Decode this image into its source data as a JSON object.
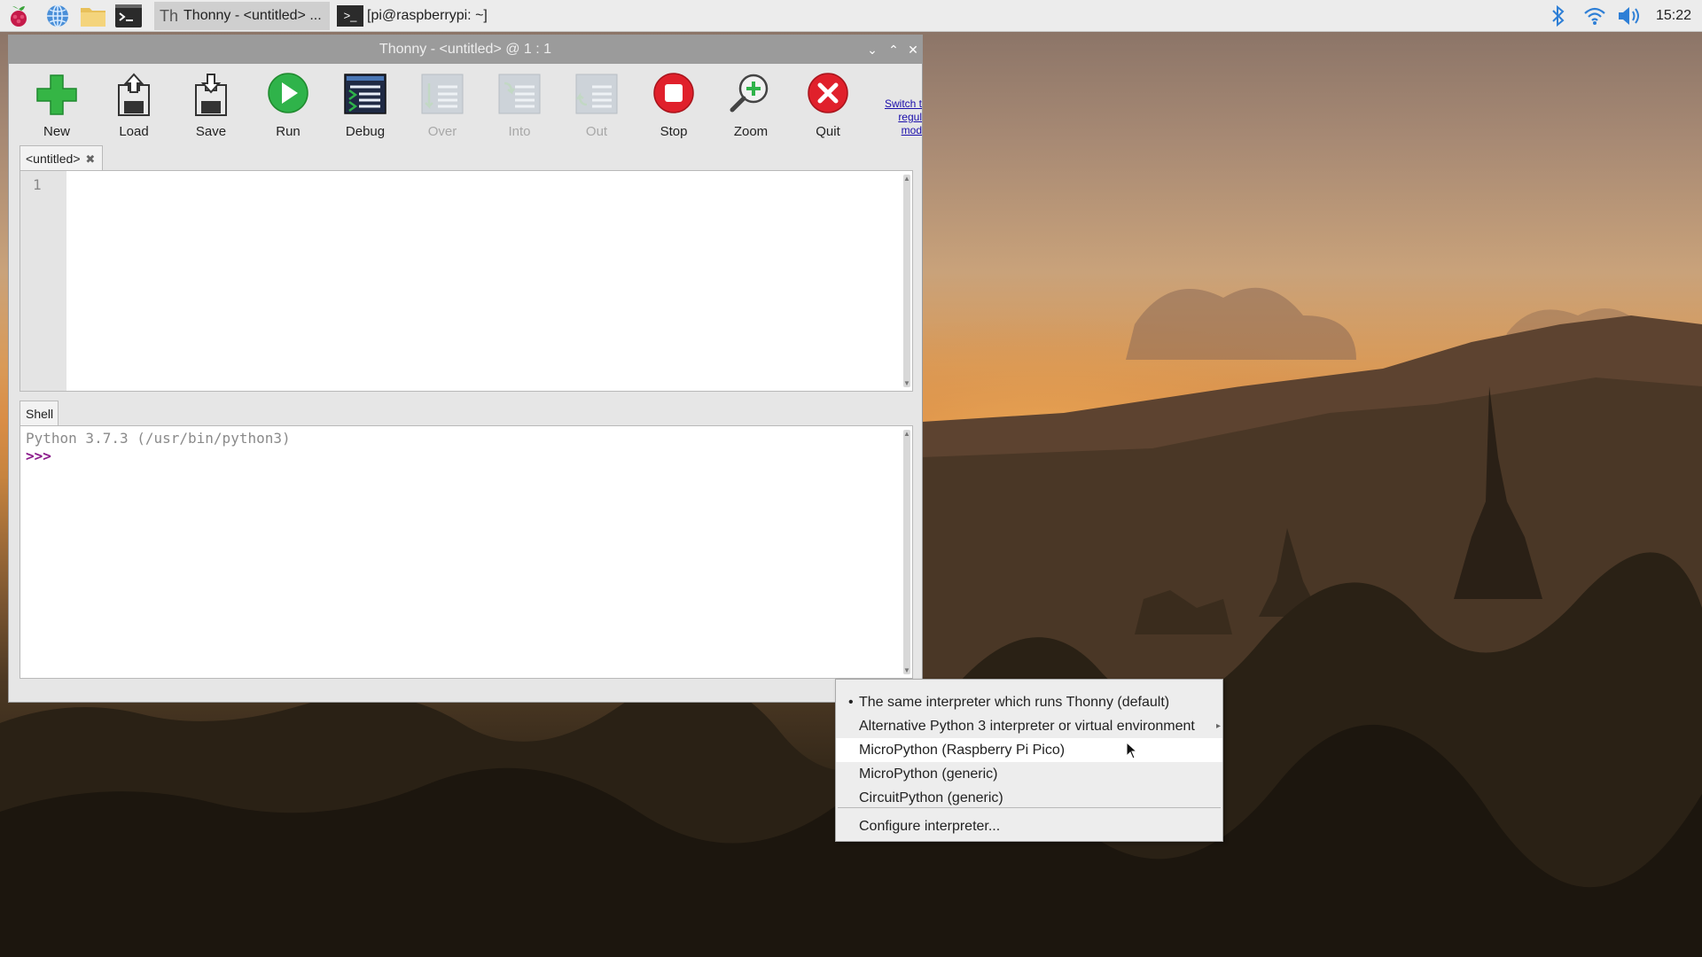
{
  "taskbar": {
    "icons": [
      "raspberry-menu-icon",
      "browser-icon",
      "file-manager-icon",
      "terminal-icon"
    ],
    "tasks": [
      {
        "label": "Thonny  -  <untitled>  ...",
        "icon": "thonny-icon"
      },
      {
        "label": "[pi@raspberrypi: ~]",
        "icon": "terminal-icon"
      }
    ],
    "clock": "15:22",
    "status_icons": [
      "bluetooth-icon",
      "wifi-icon",
      "volume-icon"
    ]
  },
  "window": {
    "title": "Thonny  -  <untitled>  @  1 : 1",
    "controls": [
      "minimize-icon",
      "maximize-icon",
      "close-icon"
    ]
  },
  "toolbar": {
    "buttons": [
      {
        "label": "New",
        "icon": "new-file-icon",
        "enabled": true
      },
      {
        "label": "Load",
        "icon": "load-icon",
        "enabled": true
      },
      {
        "label": "Save",
        "icon": "save-icon",
        "enabled": true
      },
      {
        "label": "Run",
        "icon": "run-icon",
        "enabled": true
      },
      {
        "label": "Debug",
        "icon": "debug-icon",
        "enabled": true
      },
      {
        "label": "Over",
        "icon": "step-over-icon",
        "enabled": false
      },
      {
        "label": "Into",
        "icon": "step-into-icon",
        "enabled": false
      },
      {
        "label": "Out",
        "icon": "step-out-icon",
        "enabled": false
      },
      {
        "label": "Stop",
        "icon": "stop-icon",
        "enabled": true
      },
      {
        "label": "Zoom",
        "icon": "zoom-icon",
        "enabled": true
      },
      {
        "label": "Quit",
        "icon": "quit-icon",
        "enabled": true
      }
    ],
    "switch_link": [
      "Switch t",
      "regul",
      "mod"
    ]
  },
  "editor": {
    "tab_label": "<untitled>",
    "line_number": "1",
    "content": ""
  },
  "shell": {
    "tab_label": "Shell",
    "banner": "Python 3.7.3 (/usr/bin/python3)",
    "prompt": ">>>"
  },
  "interpreter_menu": {
    "items": [
      {
        "label": "The same interpreter which runs Thonny (default)",
        "selected": true
      },
      {
        "label": "Alternative Python 3 interpreter or virtual environment",
        "submenu": true
      },
      {
        "label": "MicroPython (Raspberry Pi Pico)",
        "hovered": true
      },
      {
        "label": "MicroPython (generic)"
      },
      {
        "label": "CircuitPython (generic)"
      }
    ],
    "configure_label": "Configure interpreter..."
  },
  "colors": {
    "panel_bg": "#ececec",
    "window_title_bg": "#9b9b9b",
    "prompt_color": "#8b1a8b",
    "run_green": "#2fb34a",
    "stop_red": "#e0202b"
  }
}
